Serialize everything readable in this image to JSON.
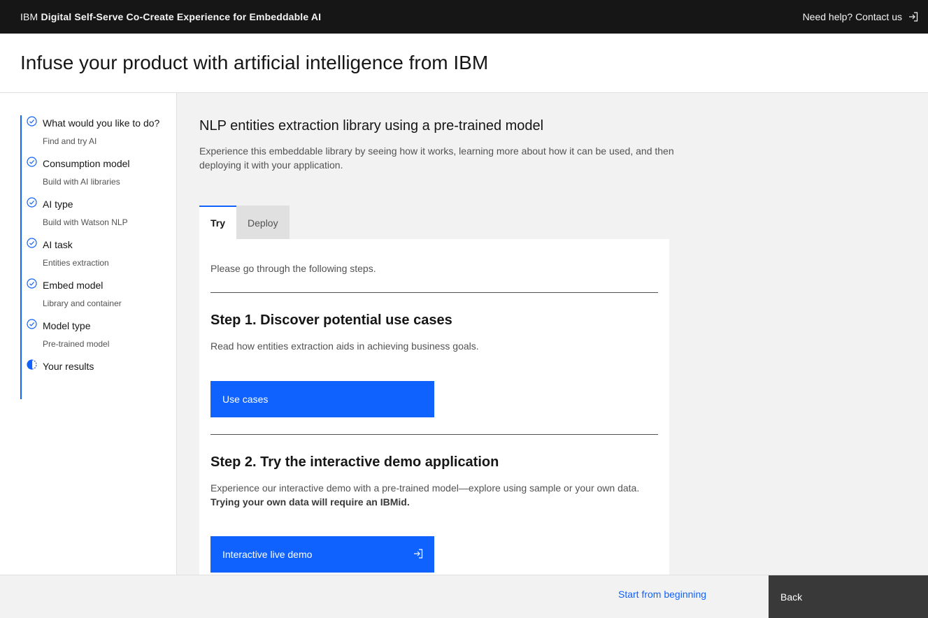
{
  "header": {
    "brand_prefix": "IBM",
    "brand_name": "Digital Self-Serve Co-Create Experience for Embeddable AI",
    "help_label": "Need help? Contact us",
    "help_icon": "login-icon"
  },
  "page": {
    "title": "Infuse your product with artificial intelligence from IBM"
  },
  "sidebar": {
    "steps": [
      {
        "label": "What would you like to do?",
        "sub": "Find and try AI",
        "status": "complete"
      },
      {
        "label": "Consumption model",
        "sub": "Build with AI libraries",
        "status": "complete"
      },
      {
        "label": "AI type",
        "sub": "Build with Watson NLP",
        "status": "complete"
      },
      {
        "label": "AI task",
        "sub": "Entities extraction",
        "status": "complete"
      },
      {
        "label": "Embed model",
        "sub": "Library and container",
        "status": "complete"
      },
      {
        "label": "Model type",
        "sub": "Pre-trained model",
        "status": "complete"
      },
      {
        "label": "Your results",
        "sub": "",
        "status": "in-progress"
      }
    ]
  },
  "main": {
    "title": "NLP entities extraction library using a pre-trained model",
    "description": "Experience this embeddable library by seeing how it works, learning more about how it can be used, and then deploying it with your application.",
    "tabs": [
      {
        "label": "Try",
        "active": true
      },
      {
        "label": "Deploy",
        "active": false
      }
    ],
    "intro": "Please go through the following steps.",
    "step1": {
      "title": "Step 1. Discover potential use cases",
      "description": "Read how entities extraction aids in achieving business goals.",
      "button_label": "Use cases"
    },
    "step2": {
      "title": "Step 2. Try the interactive demo application",
      "description": "Experience our interactive demo with a pre-trained model—explore using sample or your own data.",
      "description_bold": "Trying your own data will require an IBMid.",
      "button_label": "Interactive live demo"
    }
  },
  "footer": {
    "restart_label": "Start from beginning",
    "back_label": "Back"
  },
  "colors": {
    "accent": "#0f62fe",
    "topbar": "#161616",
    "back_button": "#393939"
  }
}
